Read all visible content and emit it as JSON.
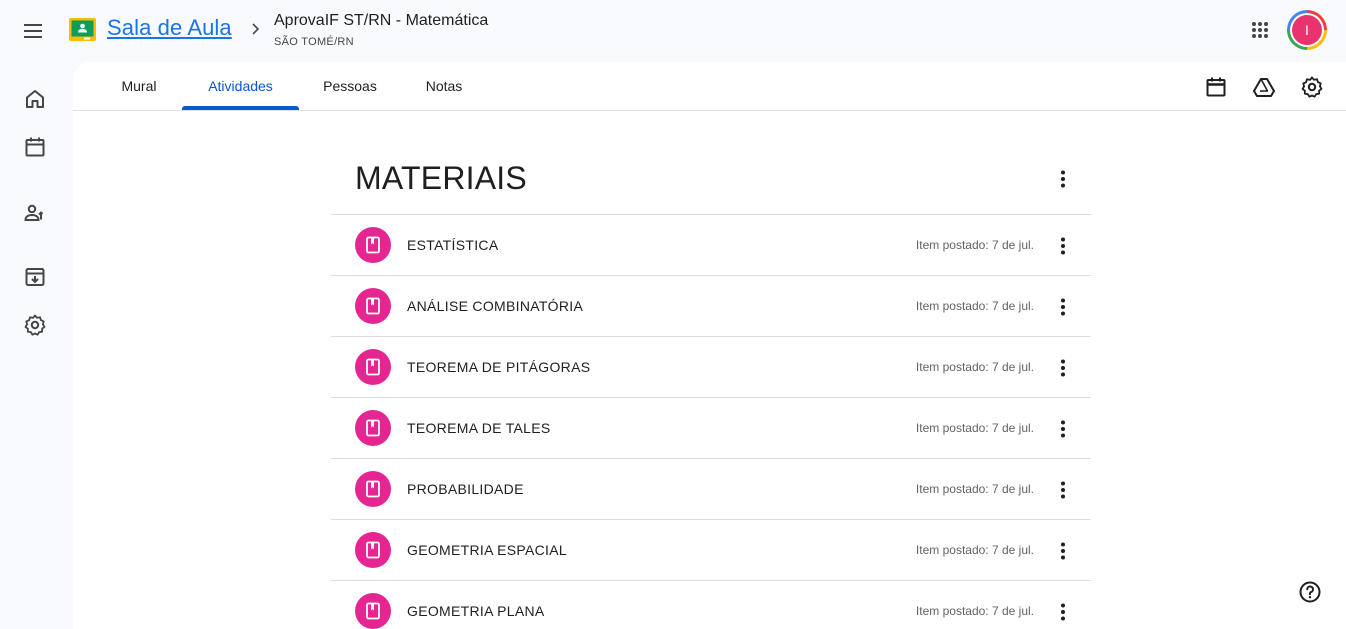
{
  "header": {
    "app_name": "Sala de Aula",
    "class_title": "AprovaIF ST/RN - Matemática",
    "class_subtitle": "SÃO TOMÉ/RN",
    "avatar_initial": "I"
  },
  "tabs": [
    {
      "label": "Mural"
    },
    {
      "label": "Atividades"
    },
    {
      "label": "Pessoas"
    },
    {
      "label": "Notas"
    }
  ],
  "section": {
    "title": "MATERIAIS"
  },
  "items": [
    {
      "title": "ESTATÍSTICA",
      "date": "Item postado: 7 de jul."
    },
    {
      "title": "ANÁLISE COMBINATÓRIA",
      "date": "Item postado: 7 de jul."
    },
    {
      "title": "TEOREMA DE PITÁGORAS",
      "date": "Item postado: 7 de jul."
    },
    {
      "title": "TEOREMA DE TALES",
      "date": "Item postado: 7 de jul."
    },
    {
      "title": "PROBABILIDADE",
      "date": "Item postado: 7 de jul."
    },
    {
      "title": "GEOMETRIA ESPACIAL",
      "date": "Item postado: 7 de jul."
    },
    {
      "title": "GEOMETRIA PLANA",
      "date": "Item postado: 7 de jul."
    }
  ],
  "colors": {
    "accent": "#0b57d0",
    "material_icon_bg": "#e52592",
    "avatar_bg": "#e8336f"
  },
  "icons": {
    "menu": "menu-icon",
    "logo": "classroom-logo-icon",
    "breadcrumb": "chevron-right-icon",
    "apps": "apps-grid-icon",
    "rail": [
      "home-icon",
      "calendar-icon",
      "people-icon",
      "archive-icon",
      "settings-icon"
    ],
    "toolbar": [
      "calendar-icon",
      "drive-icon",
      "settings-icon"
    ],
    "item": "book-icon",
    "more": "more-vert-icon",
    "help": "help-icon"
  }
}
